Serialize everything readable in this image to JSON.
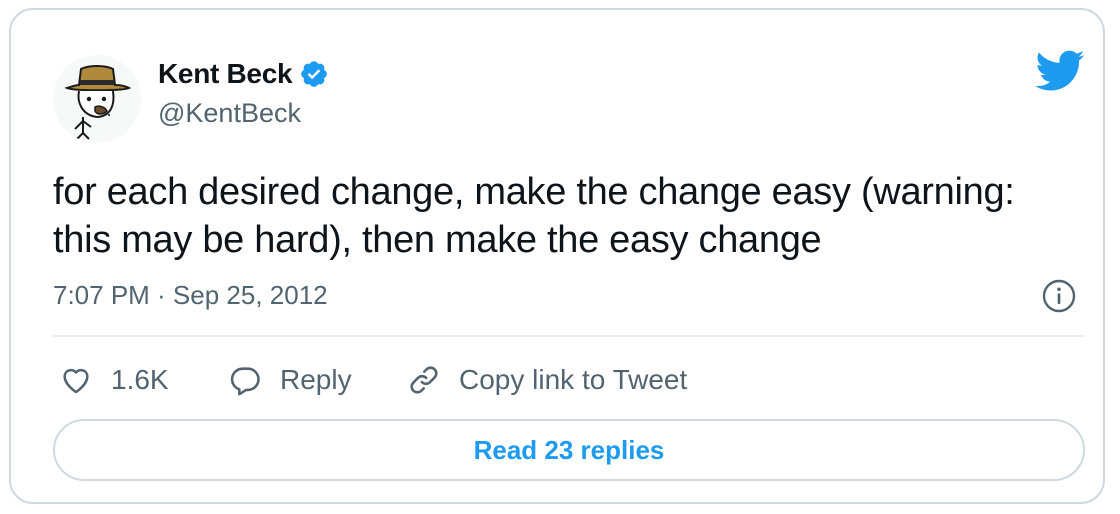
{
  "colors": {
    "accent": "#1d9bf0",
    "text_primary": "#0f1419",
    "text_secondary": "#536471",
    "border": "#cfd9de"
  },
  "author": {
    "name": "Kent Beck",
    "handle": "@KentBeck",
    "verified_icon": "verified-badge-icon",
    "avatar_icon": "avatar-fedora-character"
  },
  "brand_icon": "twitter-bird-icon",
  "tweet": {
    "text": "for each desired change, make the change easy (warning: this may be hard), then make the easy change",
    "timestamp": "7:07 PM · Sep 25, 2012",
    "info_icon": "info-icon"
  },
  "actions": {
    "like": {
      "icon": "heart-icon",
      "label": "1.6K"
    },
    "reply": {
      "icon": "speech-bubble-icon",
      "label": "Reply"
    },
    "copy_link": {
      "icon": "link-icon",
      "label": "Copy link to Tweet"
    }
  },
  "read_replies_label": "Read 23 replies"
}
